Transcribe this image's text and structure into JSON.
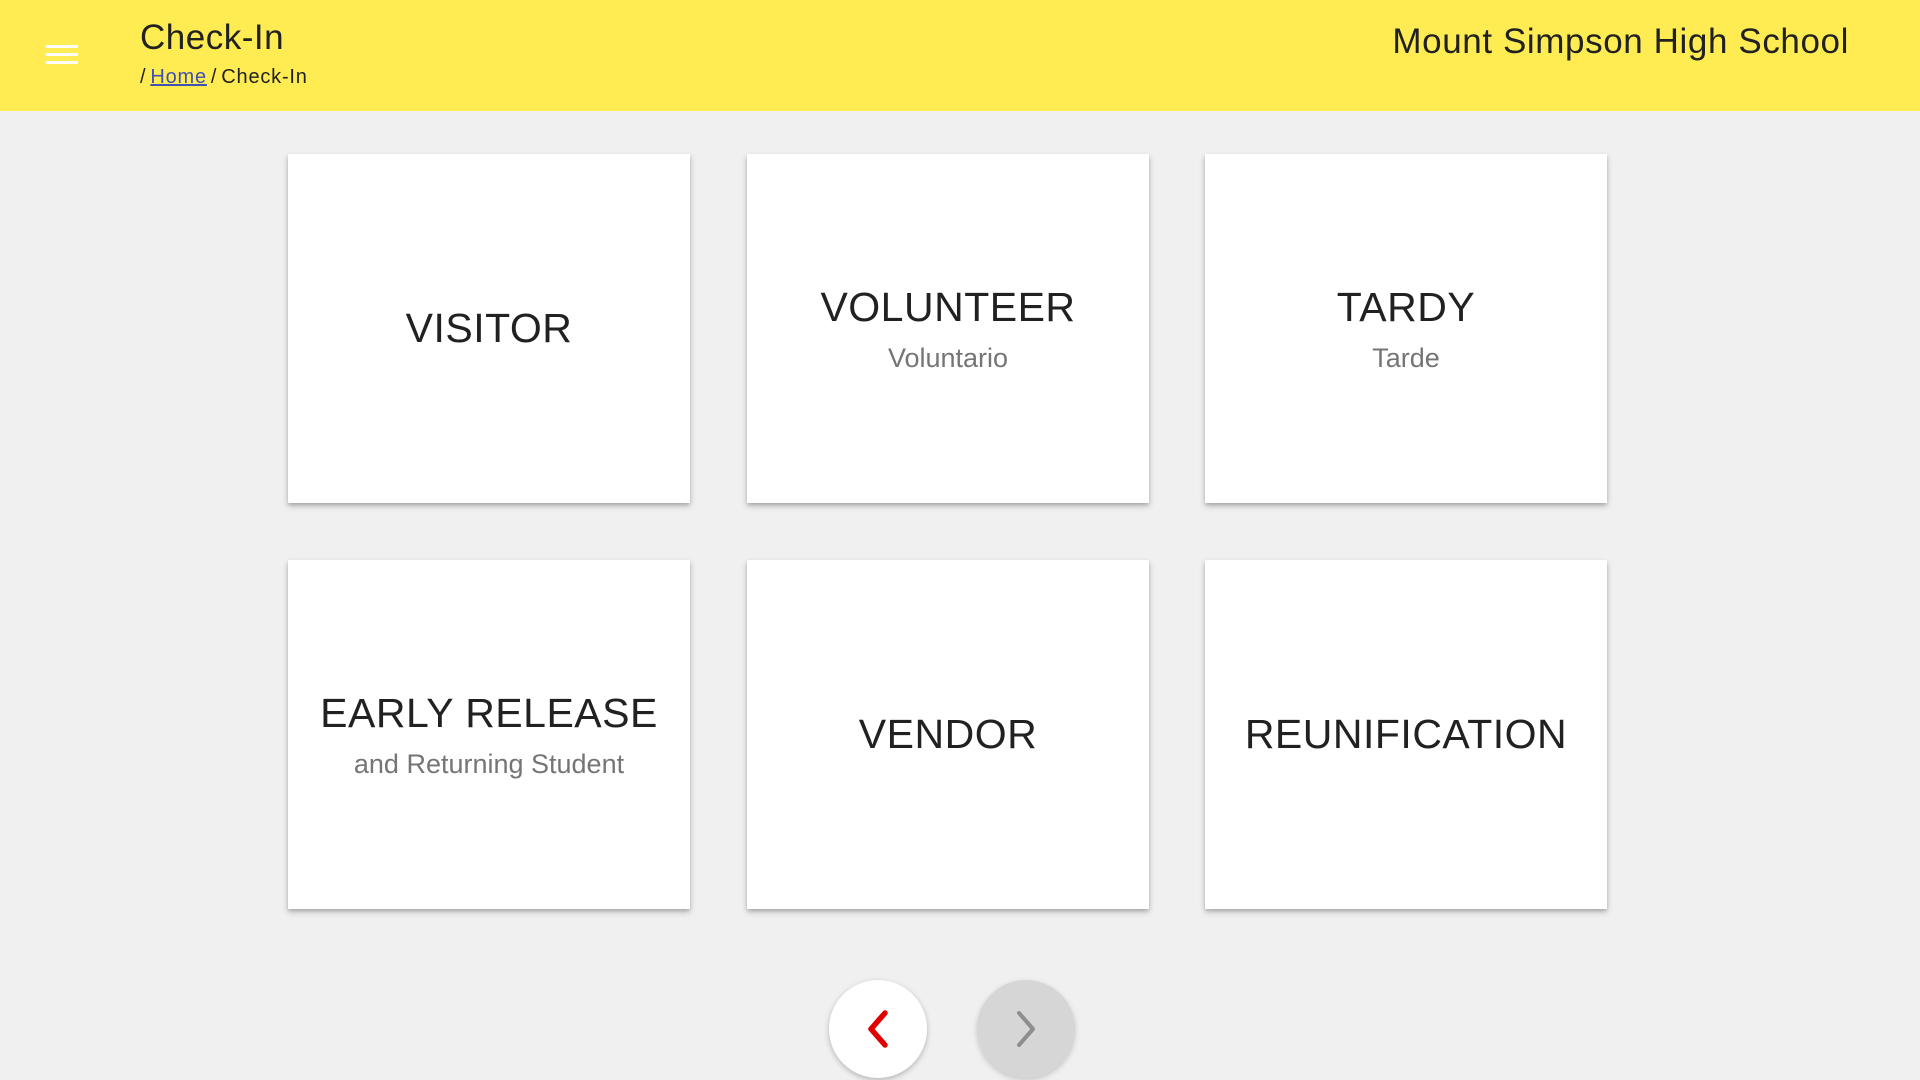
{
  "header": {
    "title": "Check-In",
    "breadcrumb": {
      "separator": "/",
      "home": "Home",
      "current": "Check-In"
    },
    "school_name": "Mount Simpson High School",
    "menu_icon": "hamburger-menu-icon",
    "background_color": "#ffec52"
  },
  "tiles": [
    {
      "label": "VISITOR",
      "sublabel": ""
    },
    {
      "label": "VOLUNTEER",
      "sublabel": "Voluntario"
    },
    {
      "label": "TARDY",
      "sublabel": "Tarde"
    },
    {
      "label": "EARLY RELEASE",
      "sublabel": "and Returning Student"
    },
    {
      "label": "VENDOR",
      "sublabel": ""
    },
    {
      "label": "REUNIFICATION",
      "sublabel": ""
    }
  ],
  "pagination": {
    "prev_icon": "chevron-left-icon",
    "prev_color": "#e00000",
    "next_icon": "chevron-right-icon",
    "next_state": "disabled"
  }
}
